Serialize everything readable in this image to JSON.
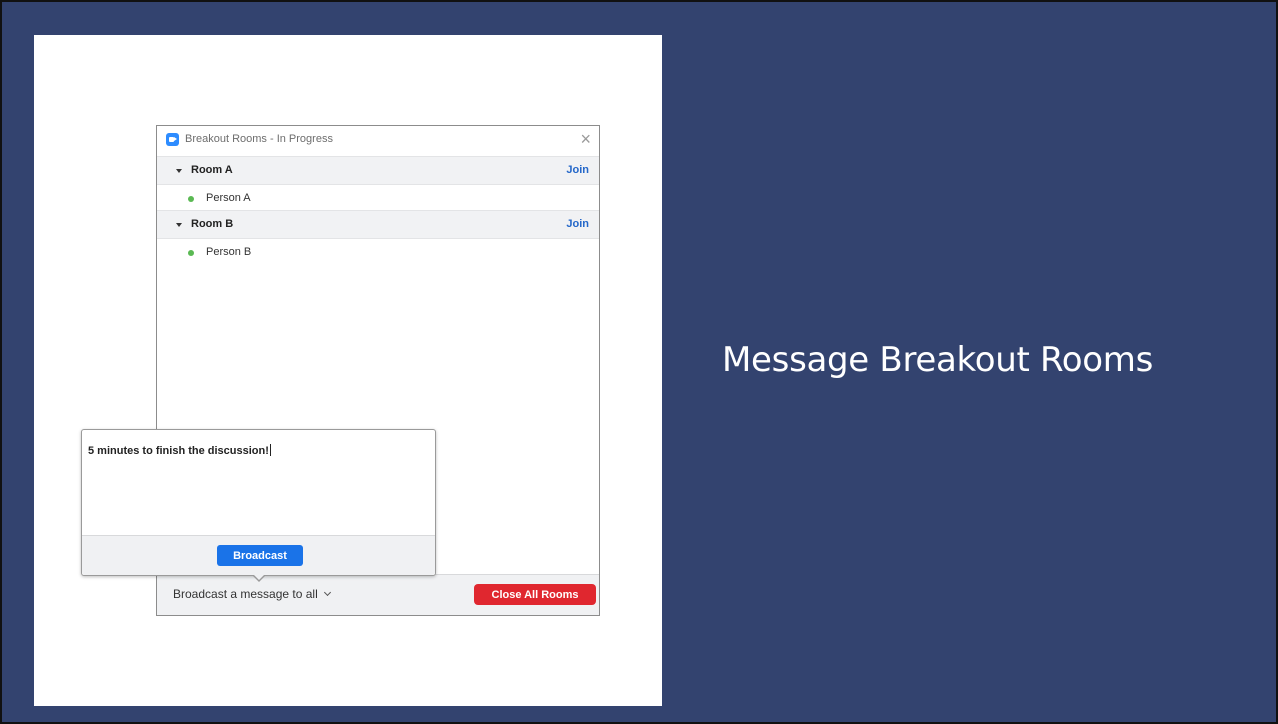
{
  "colors": {
    "slide_background": "#33436f",
    "zoom_blue": "#2d8cff",
    "join_link": "#2467c9",
    "close_all_red": "#e0272f",
    "broadcast_blue": "#1a73e8",
    "online_dot": "#5ab953"
  },
  "slide": {
    "title": "Message Breakout Rooms"
  },
  "window": {
    "app_icon": "zoom-camera-icon",
    "title": "Breakout Rooms - In Progress",
    "close_icon": "×"
  },
  "rooms": [
    {
      "name": "Room A",
      "join_label": "Join",
      "participants": [
        "Person A"
      ]
    },
    {
      "name": "Room B",
      "join_label": "Join",
      "participants": [
        "Person B"
      ]
    }
  ],
  "footer": {
    "broadcast_trigger_label": "Broadcast a message to all",
    "close_all_label": "Close All Rooms"
  },
  "broadcast_popup": {
    "message_value": "5 minutes to finish the discussion!",
    "broadcast_label": "Broadcast"
  }
}
